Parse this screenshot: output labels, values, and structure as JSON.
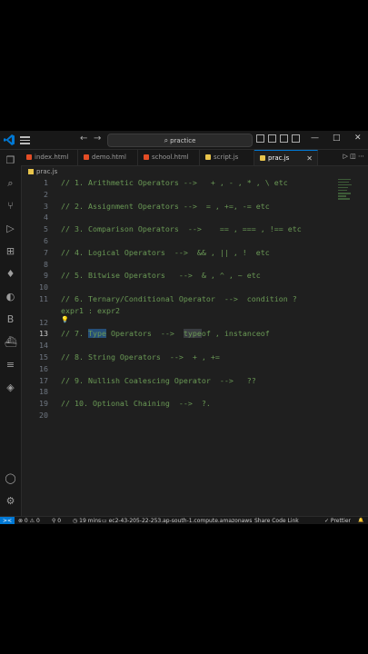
{
  "titlebar": {
    "search_text": "practice",
    "nav_back": "←",
    "nav_forward": "→",
    "minimize": "—",
    "maximize": "□",
    "close": "✕"
  },
  "tabs": [
    {
      "label": "index.html",
      "icon_color": "#e44d26",
      "active": false
    },
    {
      "label": "demo.html",
      "icon_color": "#e44d26",
      "active": false
    },
    {
      "label": "school.html",
      "icon_color": "#e44d26",
      "active": false
    },
    {
      "label": "script.js",
      "icon_color": "#e8c44b",
      "active": false
    },
    {
      "label": "prac.js",
      "icon_color": "#e8c44b",
      "active": true,
      "close": "✕"
    }
  ],
  "breadcrumb": "prac.js",
  "editor": {
    "lines": [
      {
        "n": "1",
        "text": "// 1. Arithmetic Operators -->   + , - , * , \\ etc"
      },
      {
        "n": "2",
        "text": ""
      },
      {
        "n": "3",
        "text": "// 2. Assignment Operators -->  = , +=, -= etc"
      },
      {
        "n": "4",
        "text": ""
      },
      {
        "n": "5",
        "text": "// 3. Comparison Operators  -->    == , === , !== etc"
      },
      {
        "n": "6",
        "text": ""
      },
      {
        "n": "7",
        "text": "// 4. Logical Operators  -->  && , || , !  etc"
      },
      {
        "n": "8",
        "text": ""
      },
      {
        "n": "9",
        "text": "// 5. Bitwise Operators   -->  & , ^ , ~ etc"
      },
      {
        "n": "10",
        "text": ""
      },
      {
        "n": "11",
        "text": "// 6. Ternary/Conditional Operator  -->  condition ?"
      },
      {
        "n": "",
        "text": "expr1 : expr2"
      },
      {
        "n": "12",
        "text": ""
      },
      {
        "n": "13",
        "text_parts": [
          "// 7. ",
          "Type",
          " Operators  -->  ",
          "type",
          "of , instanceof"
        ]
      },
      {
        "n": "14",
        "text": ""
      },
      {
        "n": "15",
        "text": "// 8. String Operators  -->  + , +="
      },
      {
        "n": "16",
        "text": ""
      },
      {
        "n": "17",
        "text": "// 9. Nullish Coalescing Operator  -->   ??"
      },
      {
        "n": "18",
        "text": ""
      },
      {
        "n": "19",
        "text": "// 10. Optional Chaining  -->  ?."
      },
      {
        "n": "20",
        "text": ""
      }
    ],
    "current_line": "13",
    "bulb_icon": "💡"
  },
  "statusbar": {
    "remote_icon": "><",
    "problems": "⊗ 0 ⚠ 0",
    "ports": "⚲ 0",
    "time": "◷ 19 mins",
    "host": "ec2-43-205-22-253.ap-south-1.compute.amazonaws",
    "share": "Share Code Link",
    "prettier": "✓ Prettier",
    "bell": "🔔"
  },
  "colors": {
    "comment": "#6a9955",
    "accent": "#0078d4",
    "background": "#1f1f1f"
  }
}
